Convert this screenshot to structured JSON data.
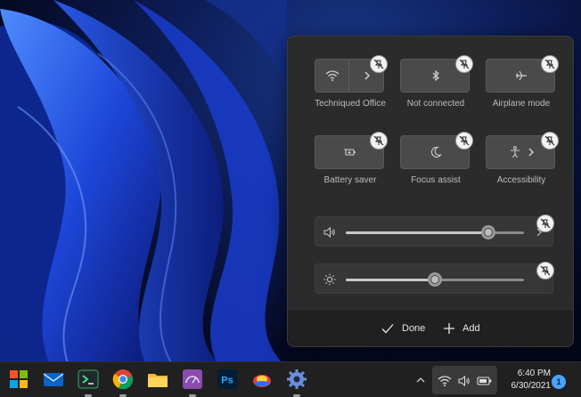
{
  "quick_settings": {
    "tiles": [
      {
        "id": "wifi",
        "label": "Techniqued Office",
        "has_chevron": true,
        "icon": "wifi-icon"
      },
      {
        "id": "bluetooth",
        "label": "Not connected",
        "has_chevron": false,
        "icon": "bluetooth-icon"
      },
      {
        "id": "airplane",
        "label": "Airplane mode",
        "has_chevron": false,
        "icon": "airplane-icon"
      },
      {
        "id": "battery",
        "label": "Battery saver",
        "has_chevron": false,
        "icon": "battery-saver-icon"
      },
      {
        "id": "focus",
        "label": "Focus assist",
        "has_chevron": false,
        "icon": "moon-icon"
      },
      {
        "id": "accessibility",
        "label": "Accessibility",
        "has_chevron": true,
        "icon": "accessibility-icon"
      }
    ],
    "volume": {
      "icon": "speaker-icon",
      "level": 0.8
    },
    "brightness": {
      "icon": "sun-icon",
      "level": 0.5
    },
    "footer": {
      "done_label": "Done",
      "add_label": "Add"
    }
  },
  "taskbar": {
    "apps": [
      "start-icon",
      "mail-icon",
      "terminal-icon",
      "chrome-icon",
      "file-explorer-icon",
      "dashboard-app-icon",
      "photoshop-icon",
      "paint-app-icon",
      "settings-icon"
    ],
    "photoshop_label": "Ps",
    "clock": {
      "time": "6:40 PM",
      "date": "6/30/2021"
    },
    "notification_count": "1"
  },
  "colors": {
    "accent": "#4aa3ff",
    "panel": "#2b2b2b",
    "tile": "#4a4a4a",
    "taskbar": "#202020"
  }
}
